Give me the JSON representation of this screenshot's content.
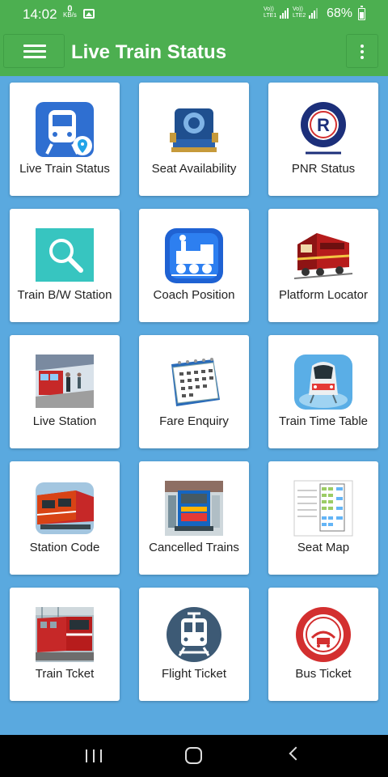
{
  "status_bar": {
    "time": "14:02",
    "net_speed_value": "0",
    "net_speed_unit": "KB/s",
    "sim1_label": "Vo)) LTE1",
    "sim2_label": "Vo)) LTE2",
    "battery": "68%"
  },
  "app_bar": {
    "title": "Live Train Status",
    "menu_icon": "hamburger-menu-icon",
    "more_icon": "more-vertical-icon",
    "color": "#4caf50"
  },
  "background_color": "#5aa9df",
  "tiles": [
    {
      "label": "Live Train Status",
      "icon": "train-location-icon"
    },
    {
      "label": "Seat Availability",
      "icon": "locomotive-emblem-icon"
    },
    {
      "label": "PNR Status",
      "icon": "railway-logo-icon"
    },
    {
      "label": "Train B/W Station",
      "icon": "search-icon"
    },
    {
      "label": "Coach Position",
      "icon": "steam-engine-icon"
    },
    {
      "label": "Platform Locator",
      "icon": "diesel-engine-icon"
    },
    {
      "label": "Live Station",
      "icon": "station-platform-icon"
    },
    {
      "label": "Fare Enquiry",
      "icon": "calendar-icon"
    },
    {
      "label": "Train Time Table",
      "icon": "metro-train-icon"
    },
    {
      "label": "Station Code",
      "icon": "electric-locomotive-icon"
    },
    {
      "label": "Cancelled Trains",
      "icon": "train-front-icon"
    },
    {
      "label": "Seat Map",
      "icon": "seat-map-icon"
    },
    {
      "label": "Train Tcket",
      "icon": "train-photo-icon"
    },
    {
      "label": "Flight Ticket",
      "icon": "tram-circle-icon"
    },
    {
      "label": "Bus Ticket",
      "icon": "railway-seal-icon"
    }
  ],
  "nav_bar": {
    "recents_icon": "recents-icon",
    "home_icon": "home-icon",
    "back_icon": "back-icon"
  }
}
